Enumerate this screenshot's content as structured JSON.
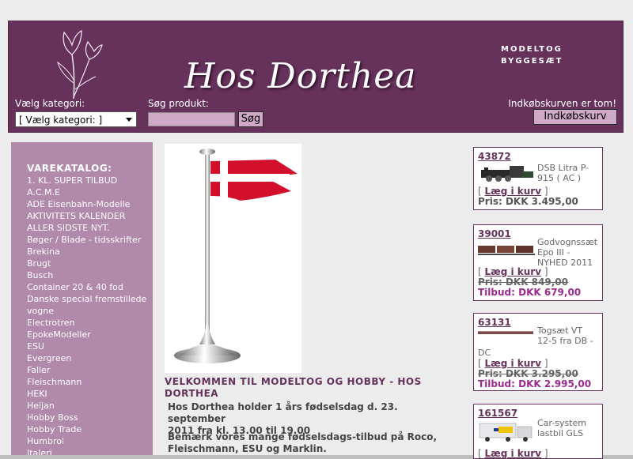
{
  "header": {
    "logo_text": "Hos Dorthea",
    "tagline_1": "MODELTOG",
    "tagline_2": "BYGGESÆT",
    "category_label": "Vælg kategori:",
    "category_value": "[ Vælg kategori: ]",
    "search_label": "Søg produkt:",
    "search_button": "Søg",
    "cart_status": "Indkøbskurven er tom!",
    "cart_button": "Indkøbskurv"
  },
  "sidebar": {
    "title": "VAREKATALOG:",
    "items": [
      "1. KL. SUPER TILBUD",
      "A.C.M.E",
      "ADE Eisenbahn-Modelle",
      "AKTIVITETS KALENDER",
      "ALLER SIDSTE NYT.",
      "Bøger / Blade - tidsskrifter",
      "Brekina",
      "Brugt",
      "Busch",
      "Container 20 & 40 fod",
      "Danske special fremstillede",
      "vogne",
      "Electrotren",
      "EpokeModeller",
      "ESU",
      "Evergreen",
      "Faller",
      "Fleischmann",
      "HEKI",
      "Heljan",
      "Hobby Boss",
      "Hobby Trade",
      "Humbrol",
      "Italeri"
    ]
  },
  "main": {
    "welcome_title_1": "VELKOMMEN TIL MODELTOG OG HOBBY - HOS",
    "welcome_title_2": "DORTHEA",
    "para1_line1": "Hos Dorthea holder 1 års fødselsdag d. 23. september",
    "para1_line2": "2011 fra kl. 13.00 til 19.00",
    "para2_line1": "Bemærk vores mange fødselsdags-tilbud på Roco,",
    "para2_line2": "Fleischmann, ESU og Marklin."
  },
  "products": [
    {
      "number": "43872",
      "name_1": "DSB Litra P-",
      "name_2": "915 ( AC )",
      "buy": "Læg i kurv",
      "price": "Pris: DKK 3.495,00"
    },
    {
      "number": "39001",
      "name_1": "Godvognssæt",
      "name_2": "Epo III -",
      "name_3": "NYHED 2011",
      "buy": "Læg i kurv",
      "old_price": "Pris: DKK 849,00",
      "offer": "Tilbud: DKK 679,00"
    },
    {
      "number": "63131",
      "name_1": "Togsæt VT",
      "name_2": "12-5 fra DB -",
      "name_3": "DC",
      "buy": "Læg i kurv",
      "old_price": "Pris: DKK 3.295,00",
      "offer": "Tilbud: DKK 2.995,00"
    },
    {
      "number": "161567",
      "name_1": "Car-system",
      "name_2": "lastbil GLS",
      "buy": "Læg i kurv"
    }
  ],
  "colors": {
    "brand": "#66325c",
    "sidebar": "#b089ab",
    "offer": "#9c2a8e"
  }
}
